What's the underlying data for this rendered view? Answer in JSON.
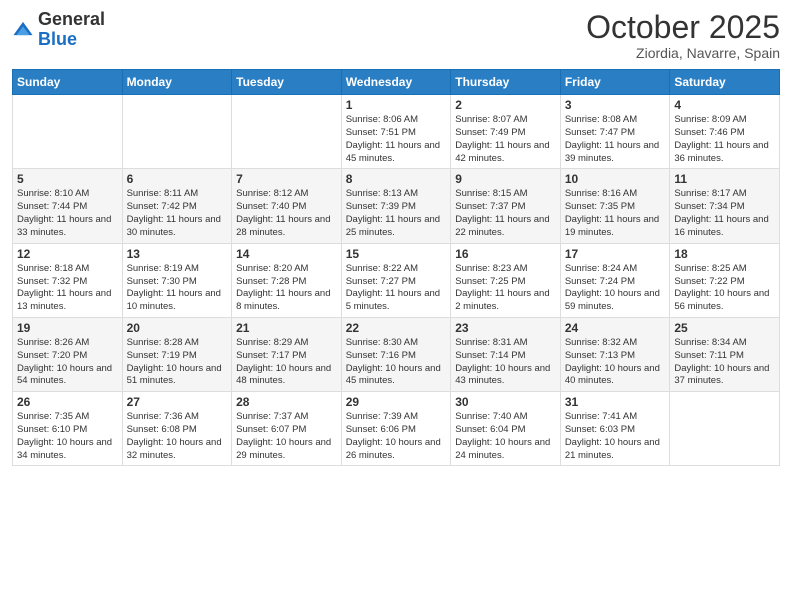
{
  "header": {
    "logo_general": "General",
    "logo_blue": "Blue",
    "month_title": "October 2025",
    "location": "Ziordia, Navarre, Spain"
  },
  "weekdays": [
    "Sunday",
    "Monday",
    "Tuesday",
    "Wednesday",
    "Thursday",
    "Friday",
    "Saturday"
  ],
  "weeks": [
    [
      {
        "day": "",
        "info": ""
      },
      {
        "day": "",
        "info": ""
      },
      {
        "day": "",
        "info": ""
      },
      {
        "day": "1",
        "info": "Sunrise: 8:06 AM\nSunset: 7:51 PM\nDaylight: 11 hours\nand 45 minutes."
      },
      {
        "day": "2",
        "info": "Sunrise: 8:07 AM\nSunset: 7:49 PM\nDaylight: 11 hours\nand 42 minutes."
      },
      {
        "day": "3",
        "info": "Sunrise: 8:08 AM\nSunset: 7:47 PM\nDaylight: 11 hours\nand 39 minutes."
      },
      {
        "day": "4",
        "info": "Sunrise: 8:09 AM\nSunset: 7:46 PM\nDaylight: 11 hours\nand 36 minutes."
      }
    ],
    [
      {
        "day": "5",
        "info": "Sunrise: 8:10 AM\nSunset: 7:44 PM\nDaylight: 11 hours\nand 33 minutes."
      },
      {
        "day": "6",
        "info": "Sunrise: 8:11 AM\nSunset: 7:42 PM\nDaylight: 11 hours\nand 30 minutes."
      },
      {
        "day": "7",
        "info": "Sunrise: 8:12 AM\nSunset: 7:40 PM\nDaylight: 11 hours\nand 28 minutes."
      },
      {
        "day": "8",
        "info": "Sunrise: 8:13 AM\nSunset: 7:39 PM\nDaylight: 11 hours\nand 25 minutes."
      },
      {
        "day": "9",
        "info": "Sunrise: 8:15 AM\nSunset: 7:37 PM\nDaylight: 11 hours\nand 22 minutes."
      },
      {
        "day": "10",
        "info": "Sunrise: 8:16 AM\nSunset: 7:35 PM\nDaylight: 11 hours\nand 19 minutes."
      },
      {
        "day": "11",
        "info": "Sunrise: 8:17 AM\nSunset: 7:34 PM\nDaylight: 11 hours\nand 16 minutes."
      }
    ],
    [
      {
        "day": "12",
        "info": "Sunrise: 8:18 AM\nSunset: 7:32 PM\nDaylight: 11 hours\nand 13 minutes."
      },
      {
        "day": "13",
        "info": "Sunrise: 8:19 AM\nSunset: 7:30 PM\nDaylight: 11 hours\nand 10 minutes."
      },
      {
        "day": "14",
        "info": "Sunrise: 8:20 AM\nSunset: 7:28 PM\nDaylight: 11 hours\nand 8 minutes."
      },
      {
        "day": "15",
        "info": "Sunrise: 8:22 AM\nSunset: 7:27 PM\nDaylight: 11 hours\nand 5 minutes."
      },
      {
        "day": "16",
        "info": "Sunrise: 8:23 AM\nSunset: 7:25 PM\nDaylight: 11 hours\nand 2 minutes."
      },
      {
        "day": "17",
        "info": "Sunrise: 8:24 AM\nSunset: 7:24 PM\nDaylight: 10 hours\nand 59 minutes."
      },
      {
        "day": "18",
        "info": "Sunrise: 8:25 AM\nSunset: 7:22 PM\nDaylight: 10 hours\nand 56 minutes."
      }
    ],
    [
      {
        "day": "19",
        "info": "Sunrise: 8:26 AM\nSunset: 7:20 PM\nDaylight: 10 hours\nand 54 minutes."
      },
      {
        "day": "20",
        "info": "Sunrise: 8:28 AM\nSunset: 7:19 PM\nDaylight: 10 hours\nand 51 minutes."
      },
      {
        "day": "21",
        "info": "Sunrise: 8:29 AM\nSunset: 7:17 PM\nDaylight: 10 hours\nand 48 minutes."
      },
      {
        "day": "22",
        "info": "Sunrise: 8:30 AM\nSunset: 7:16 PM\nDaylight: 10 hours\nand 45 minutes."
      },
      {
        "day": "23",
        "info": "Sunrise: 8:31 AM\nSunset: 7:14 PM\nDaylight: 10 hours\nand 43 minutes."
      },
      {
        "day": "24",
        "info": "Sunrise: 8:32 AM\nSunset: 7:13 PM\nDaylight: 10 hours\nand 40 minutes."
      },
      {
        "day": "25",
        "info": "Sunrise: 8:34 AM\nSunset: 7:11 PM\nDaylight: 10 hours\nand 37 minutes."
      }
    ],
    [
      {
        "day": "26",
        "info": "Sunrise: 7:35 AM\nSunset: 6:10 PM\nDaylight: 10 hours\nand 34 minutes."
      },
      {
        "day": "27",
        "info": "Sunrise: 7:36 AM\nSunset: 6:08 PM\nDaylight: 10 hours\nand 32 minutes."
      },
      {
        "day": "28",
        "info": "Sunrise: 7:37 AM\nSunset: 6:07 PM\nDaylight: 10 hours\nand 29 minutes."
      },
      {
        "day": "29",
        "info": "Sunrise: 7:39 AM\nSunset: 6:06 PM\nDaylight: 10 hours\nand 26 minutes."
      },
      {
        "day": "30",
        "info": "Sunrise: 7:40 AM\nSunset: 6:04 PM\nDaylight: 10 hours\nand 24 minutes."
      },
      {
        "day": "31",
        "info": "Sunrise: 7:41 AM\nSunset: 6:03 PM\nDaylight: 10 hours\nand 21 minutes."
      },
      {
        "day": "",
        "info": ""
      }
    ]
  ]
}
